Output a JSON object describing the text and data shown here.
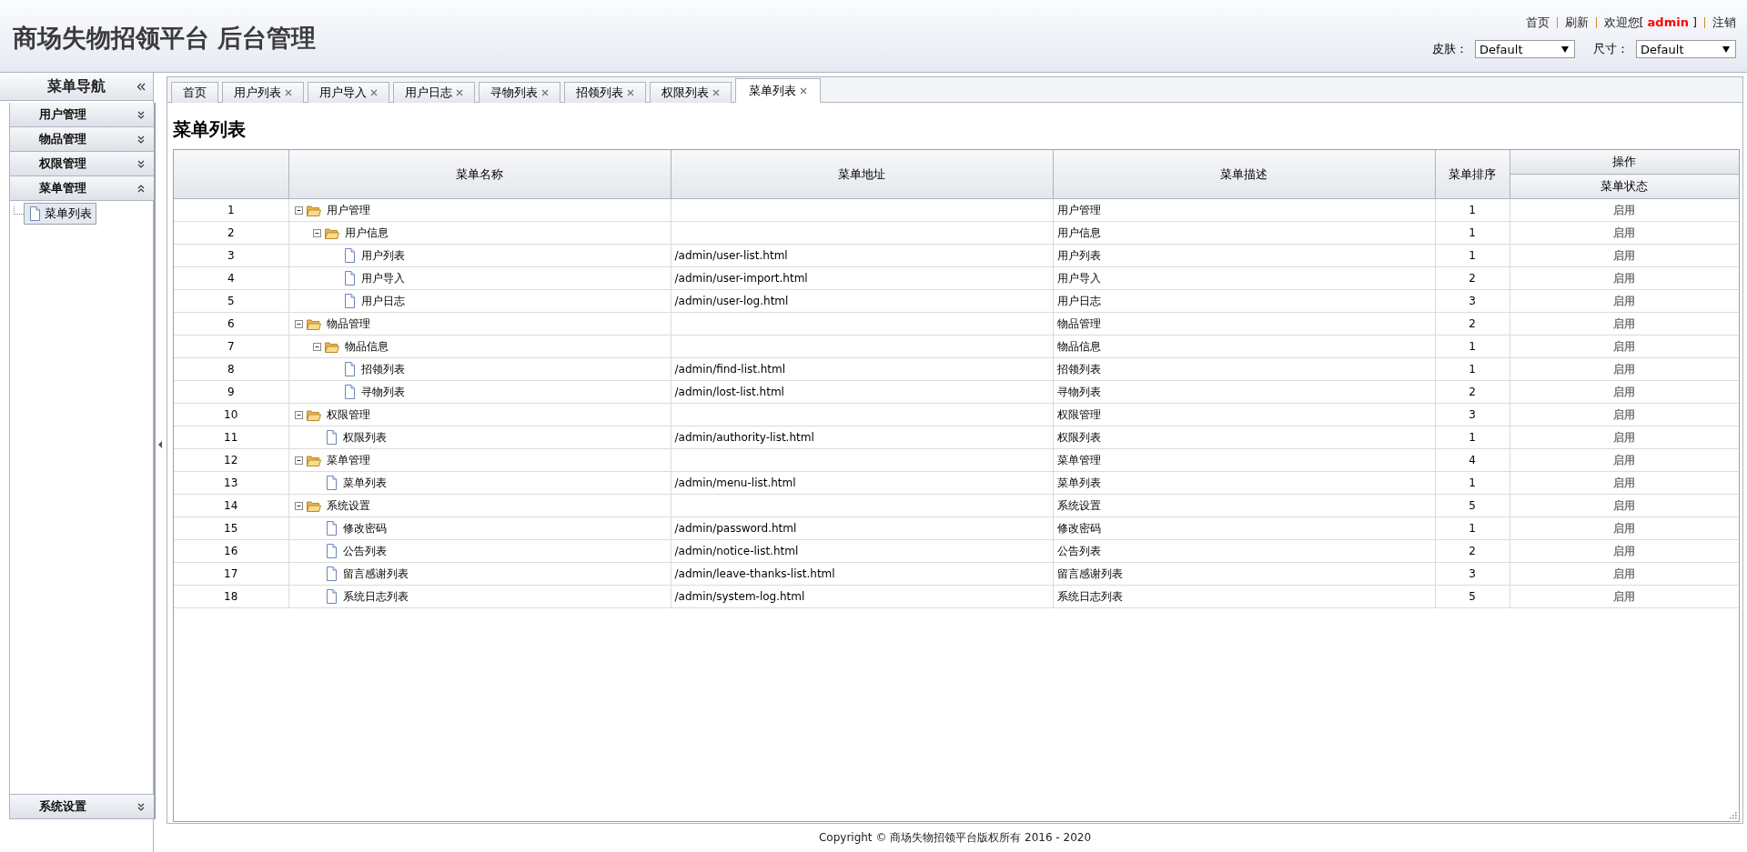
{
  "header": {
    "title": "商场失物招领平台 后台管理",
    "links": [
      {
        "label": "首页"
      },
      {
        "label": "刷新"
      }
    ],
    "welcome": {
      "prefix": "欢迎您[",
      "user": "admin",
      "suffix": "]"
    },
    "logout": "注销",
    "selects": [
      {
        "label": "皮肤：",
        "value": "Default"
      },
      {
        "label": "尺寸：",
        "value": "Default"
      }
    ]
  },
  "sidebar": {
    "title": "菜单导航",
    "sections": [
      {
        "title": "用户管理",
        "expanded": false
      },
      {
        "title": "物品管理",
        "expanded": false
      },
      {
        "title": "权限管理",
        "expanded": false
      },
      {
        "title": "菜单管理",
        "expanded": true,
        "items": [
          {
            "label": "菜单列表",
            "selected": true
          }
        ]
      }
    ],
    "bottom_section": {
      "title": "系统设置",
      "expanded": false
    }
  },
  "tabs": [
    {
      "label": "首页",
      "closable": false,
      "selected": false
    },
    {
      "label": "用户列表",
      "closable": true,
      "selected": false
    },
    {
      "label": "用户导入",
      "closable": true,
      "selected": false
    },
    {
      "label": "用户日志",
      "closable": true,
      "selected": false
    },
    {
      "label": "寻物列表",
      "closable": true,
      "selected": false
    },
    {
      "label": "招领列表",
      "closable": true,
      "selected": false
    },
    {
      "label": "权限列表",
      "closable": true,
      "selected": false
    },
    {
      "label": "菜单列表",
      "closable": true,
      "selected": true
    }
  ],
  "page_title": "菜单列表",
  "table": {
    "columns": [
      "菜单名称",
      "菜单地址",
      "菜单描述",
      "菜单排序"
    ],
    "group_header": "操作",
    "group_columns": [
      "菜单状态"
    ],
    "rows": [
      {
        "index": "1",
        "name": "用户管理",
        "kind": "folder",
        "expanded": true,
        "description": "用户管理",
        "order": "1",
        "status": "启用",
        "children": [
          {
            "index": "2",
            "name": "用户信息",
            "kind": "folder",
            "expanded": true,
            "description": "用户信息",
            "order": "1",
            "status": "启用",
            "children": [
              {
                "index": "3",
                "name": "用户列表",
                "kind": "page",
                "url": "/admin/user-list.html",
                "description": "用户列表",
                "order": "1",
                "status": "启用"
              },
              {
                "index": "4",
                "name": "用户导入",
                "kind": "page",
                "url": "/admin/user-import.html",
                "description": "用户导入",
                "order": "2",
                "status": "启用"
              },
              {
                "index": "5",
                "name": "用户日志",
                "kind": "page",
                "url": "/admin/user-log.html",
                "description": "用户日志",
                "order": "3",
                "status": "启用"
              }
            ]
          }
        ]
      },
      {
        "index": "6",
        "name": "物品管理",
        "kind": "folder",
        "expanded": true,
        "description": "物品管理",
        "order": "2",
        "status": "启用",
        "children": [
          {
            "index": "7",
            "name": "物品信息",
            "kind": "folder",
            "expanded": true,
            "description": "物品信息",
            "order": "1",
            "status": "启用",
            "children": [
              {
                "index": "8",
                "name": "招领列表",
                "kind": "page",
                "url": "/admin/find-list.html",
                "description": "招领列表",
                "order": "1",
                "status": "启用"
              },
              {
                "index": "9",
                "name": "寻物列表",
                "kind": "page",
                "url": "/admin/lost-list.html",
                "description": "寻物列表",
                "order": "2",
                "status": "启用"
              }
            ]
          }
        ]
      },
      {
        "index": "10",
        "name": "权限管理",
        "kind": "folder",
        "expanded": true,
        "description": "权限管理",
        "order": "3",
        "status": "启用",
        "children": [
          {
            "index": "11",
            "name": "权限列表",
            "kind": "page",
            "url": "/admin/authority-list.html",
            "description": "权限列表",
            "order": "1",
            "status": "启用"
          }
        ]
      },
      {
        "index": "12",
        "name": "菜单管理",
        "kind": "folder",
        "expanded": true,
        "description": "菜单管理",
        "order": "4",
        "status": "启用",
        "children": [
          {
            "index": "13",
            "name": "菜单列表",
            "kind": "page",
            "url": "/admin/menu-list.html",
            "description": "菜单列表",
            "order": "1",
            "status": "启用"
          }
        ]
      },
      {
        "index": "14",
        "name": "系统设置",
        "kind": "folder",
        "expanded": true,
        "description": "系统设置",
        "order": "5",
        "status": "启用",
        "children": [
          {
            "index": "15",
            "name": "修改密码",
            "kind": "page",
            "url": "/admin/password.html",
            "description": "修改密码",
            "order": "1",
            "status": "启用"
          },
          {
            "index": "16",
            "name": "公告列表",
            "kind": "page",
            "url": "/admin/notice-list.html",
            "description": "公告列表",
            "order": "2",
            "status": "启用"
          },
          {
            "index": "17",
            "name": "留言感谢列表",
            "kind": "page",
            "url": "/admin/leave-thanks-list.html",
            "description": "留言感谢列表",
            "order": "3",
            "status": "启用"
          },
          {
            "index": "18",
            "name": "系统日志列表",
            "kind": "page",
            "url": "/admin/system-log.html",
            "description": "系统日志列表",
            "order": "5",
            "status": "启用"
          }
        ]
      }
    ]
  },
  "footer": "Copyright © 商场失物招领平台版权所有  2016 - 2020"
}
